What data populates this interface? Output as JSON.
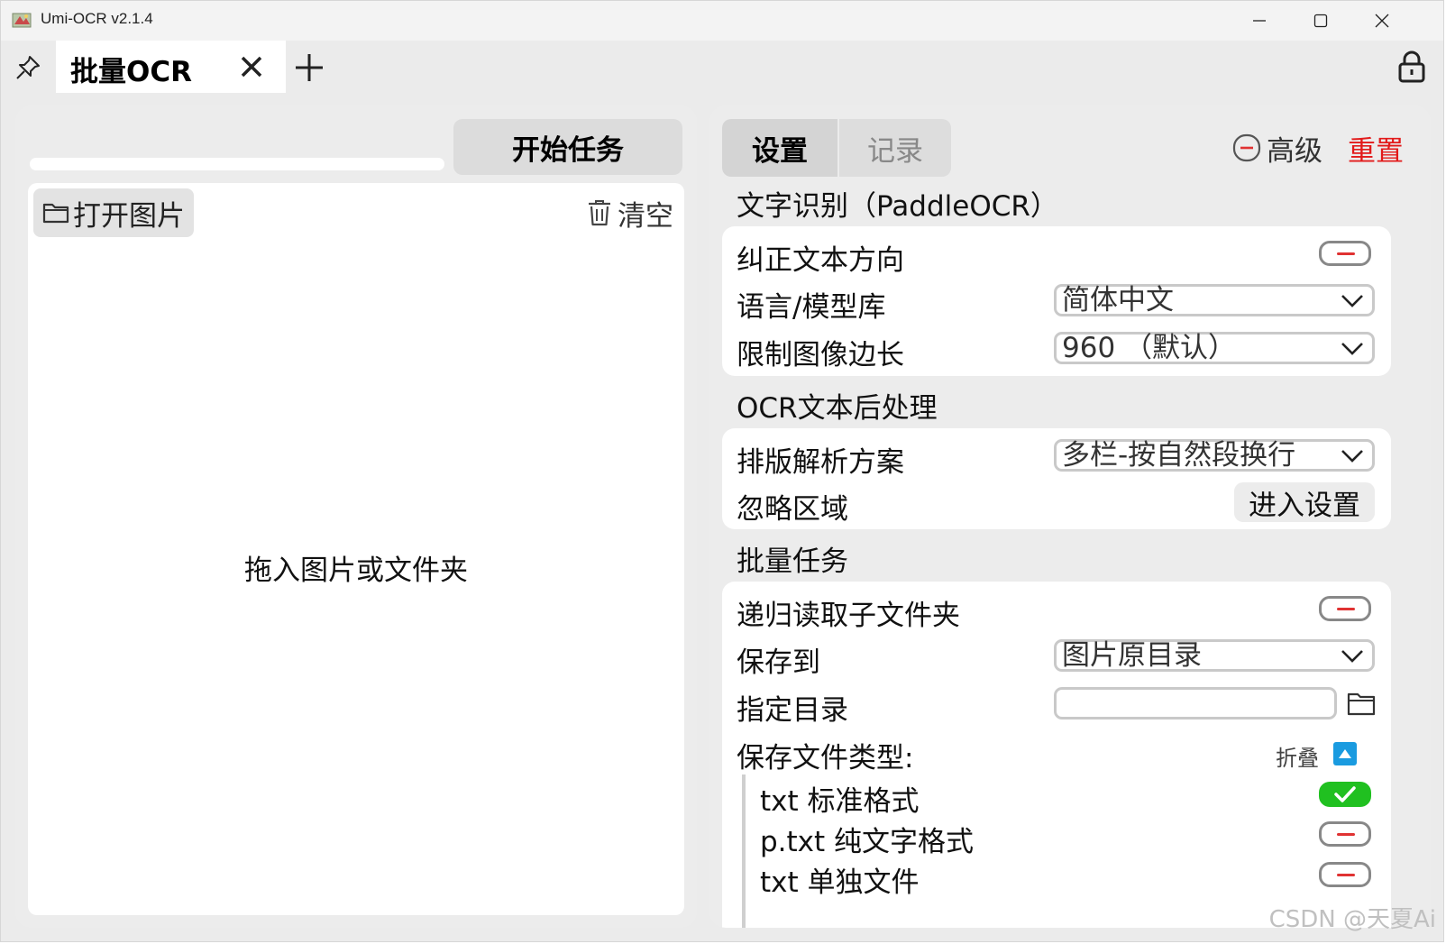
{
  "window": {
    "title": "Umi-OCR v2.1.4",
    "minimize_icon": "minimize-icon",
    "maximize_icon": "maximize-icon",
    "close_icon": "close-icon"
  },
  "tabs": [
    {
      "label": "批量OCR",
      "active": true
    }
  ],
  "left": {
    "start_button": "开始任务",
    "progress_percent": 0,
    "open_images": "打开图片",
    "clear": "清空",
    "drop_hint": "拖入图片或文件夹"
  },
  "right": {
    "tab_settings": "设置",
    "tab_records": "记录",
    "advanced": "高级",
    "reset": "重置",
    "ocr_section": {
      "title": "文字识别（PaddleOCR）",
      "correct_direction": {
        "label": "纠正文本方向",
        "on": false
      },
      "language": {
        "label": "语言/模型库",
        "value": "简体中文"
      },
      "limit_side": {
        "label": "限制图像边长",
        "value": "960 （默认）"
      }
    },
    "post_section": {
      "title": "OCR文本后处理",
      "layout": {
        "label": "排版解析方案",
        "value": "多栏-按自然段换行"
      },
      "ignore_area": {
        "label": "忽略区域",
        "button": "进入设置"
      }
    },
    "batch_section": {
      "title": "批量任务",
      "recursive": {
        "label": "递归读取子文件夹",
        "on": false
      },
      "save_to": {
        "label": "保存到",
        "value": "图片原目录"
      },
      "target_dir": {
        "label": "指定目录",
        "value": ""
      },
      "file_types": {
        "label": "保存文件类型:",
        "collapse": "折叠",
        "items": [
          {
            "label": "txt 标准格式",
            "on": true
          },
          {
            "label": "p.txt 纯文字格式",
            "on": false
          },
          {
            "label": "txt 单独文件",
            "on": false
          }
        ]
      }
    }
  },
  "watermark": "CSDN @天夏Ai",
  "colors": {
    "accent_red": "#e21a1a",
    "toggle_on": "#20c020",
    "collapse_blue": "#1a9be0"
  }
}
